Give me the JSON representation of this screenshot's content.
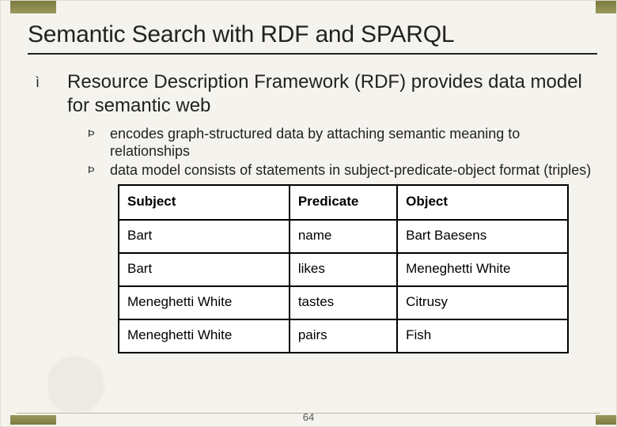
{
  "title": "Semantic Search with RDF and SPARQL",
  "level1_bullet_glyph": "ì",
  "level2_bullet_glyph": "Þ",
  "main_bullet": "Resource Description Framework (RDF) provides data model for semantic web",
  "sub_bullets": [
    "encodes graph-structured data by attaching semantic meaning to relationships",
    "data model consists of statements in subject-predicate-object format (triples)"
  ],
  "table": {
    "headers": [
      "Subject",
      "Predicate",
      "Object"
    ],
    "rows": [
      [
        "Bart",
        "name",
        "Bart Baesens"
      ],
      [
        "Bart",
        "likes",
        "Meneghetti White"
      ],
      [
        "Meneghetti White",
        "tastes",
        "Citrusy"
      ],
      [
        "Meneghetti White",
        "pairs",
        "Fish"
      ]
    ]
  },
  "page_number": "64"
}
